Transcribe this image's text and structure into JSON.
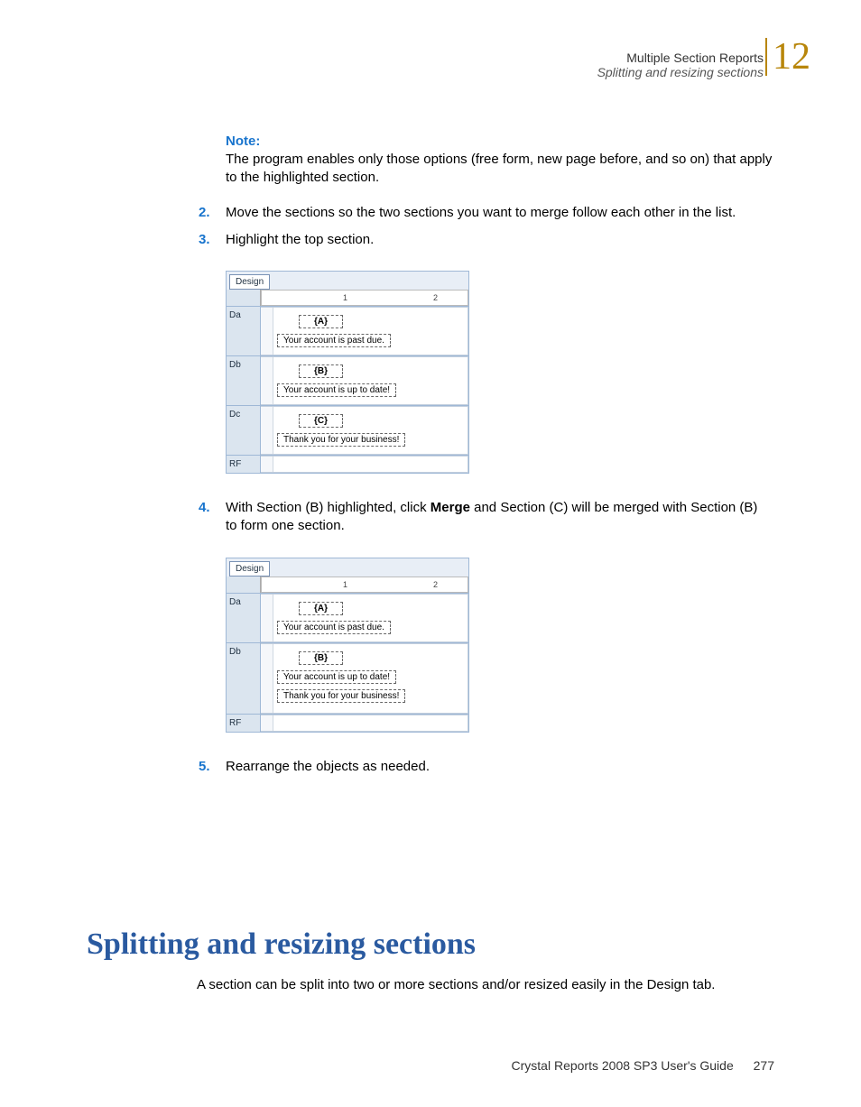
{
  "header": {
    "chapter_title": "Multiple Section Reports",
    "section_title": "Splitting and resizing sections",
    "chapter_number": "12"
  },
  "note": {
    "label": "Note:",
    "text": "The program enables only those options (free form, new page before, and so on) that apply to the highlighted section."
  },
  "steps": {
    "s2": {
      "num": "2.",
      "text": "Move the sections so the two sections you want to merge follow each other in the list."
    },
    "s3": {
      "num": "3.",
      "text": "Highlight the top section."
    },
    "s4": {
      "num": "4.",
      "prefix": "With Section (B) highlighted, click ",
      "bold": "Merge",
      "suffix": " and Section (C) will be merged with Section (B) to form one section."
    },
    "s5": {
      "num": "5.",
      "text": "Rearrange the objects as needed."
    }
  },
  "figure1": {
    "tab": "Design",
    "ruler_1": "1",
    "ruler_2": "2",
    "rows": {
      "da": {
        "label": "Da",
        "head": "{A}",
        "text": "Your account is past due."
      },
      "db": {
        "label": "Db",
        "head": "{B}",
        "text": "Your account is up to date!"
      },
      "dc": {
        "label": "Dc",
        "head": "{C}",
        "text": "Thank you for your business!"
      },
      "rf": {
        "label": "RF"
      }
    }
  },
  "figure2": {
    "tab": "Design",
    "ruler_1": "1",
    "ruler_2": "2",
    "rows": {
      "da": {
        "label": "Da",
        "head": "{A}",
        "text": "Your account is past due."
      },
      "db": {
        "label": "Db",
        "head": "{B}",
        "text1": "Your account is up to date!",
        "text2": "Thank you for your business!"
      },
      "rf": {
        "label": "RF"
      }
    }
  },
  "heading": "Splitting and resizing sections",
  "intro": "A section can be split into two or more sections and/or resized easily in the Design tab.",
  "footer": {
    "guide": "Crystal Reports 2008 SP3 User's Guide",
    "page": "277"
  }
}
